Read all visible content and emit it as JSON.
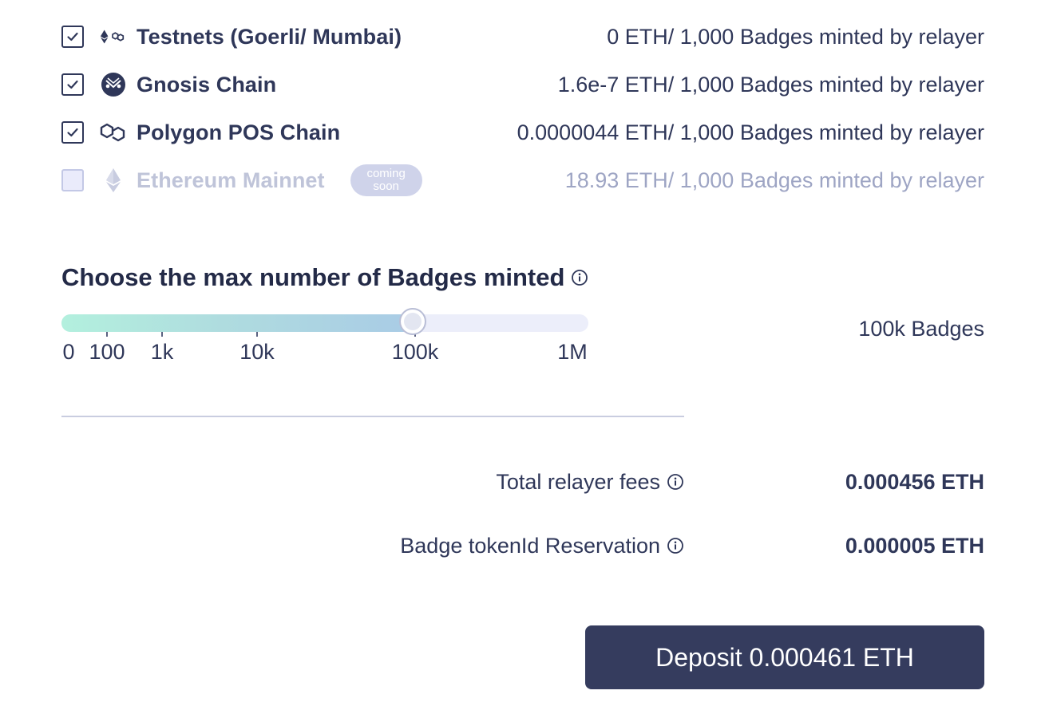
{
  "networks": [
    {
      "name": "Testnets (Goerli/ Mumbai)",
      "fee": "0 ETH/ 1,000 Badges minted by relayer",
      "checked": true,
      "disabled": false,
      "icon": "testnets-icon"
    },
    {
      "name": "Gnosis Chain",
      "fee": "1.6e-7 ETH/ 1,000 Badges minted by relayer",
      "checked": true,
      "disabled": false,
      "icon": "gnosis-icon"
    },
    {
      "name": "Polygon POS Chain",
      "fee": "0.0000044 ETH/ 1,000 Badges minted by relayer",
      "checked": true,
      "disabled": false,
      "icon": "polygon-icon"
    },
    {
      "name": "Ethereum Mainnet",
      "fee": "18.93 ETH/ 1,000 Badges minted by relayer",
      "checked": false,
      "disabled": true,
      "icon": "ethereum-icon",
      "badge_line1": "coming",
      "badge_line2": "soon"
    }
  ],
  "max_badges": {
    "title": "Choose the max number of Badges minted",
    "ticks": [
      "0",
      "100",
      "1k",
      "10k",
      "100k",
      "1M"
    ],
    "selected_fraction": 0.667,
    "value_label": "100k Badges"
  },
  "fees": {
    "relayer_label": "Total relayer fees",
    "relayer_value": "0.000456 ETH",
    "reservation_label": "Badge tokenId Reservation",
    "reservation_value": "0.000005 ETH"
  },
  "deposit_button": "Deposit 0.000461 ETH",
  "colors": {
    "text": "#2f3759",
    "button": "#353c5e",
    "disabled_text": "#bfc4d9",
    "slider_fill_start": "#b3f0de",
    "slider_fill_end": "#a9cbe6"
  }
}
